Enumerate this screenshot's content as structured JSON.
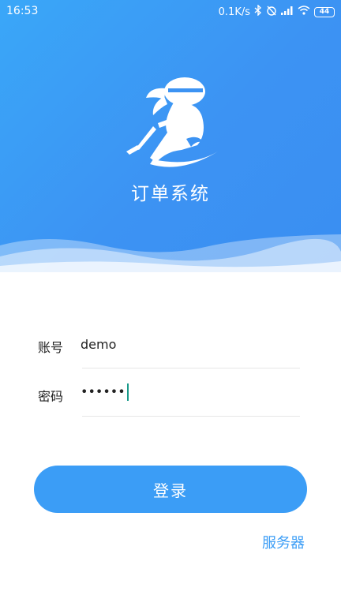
{
  "status_bar": {
    "time": "16:53",
    "network_speed": "0.1K/s",
    "battery": "44"
  },
  "header": {
    "title": "订单系统"
  },
  "form": {
    "account_label": "账号",
    "account_value": "demo",
    "password_label": "密码",
    "password_value": "••••••"
  },
  "actions": {
    "login_label": "登录",
    "server_label": "服务器"
  },
  "colors": {
    "primary": "#3b9df6",
    "header_gradient_start": "#3aa7f8",
    "header_gradient_end": "#3a8ef2",
    "caret": "#199a8a"
  }
}
